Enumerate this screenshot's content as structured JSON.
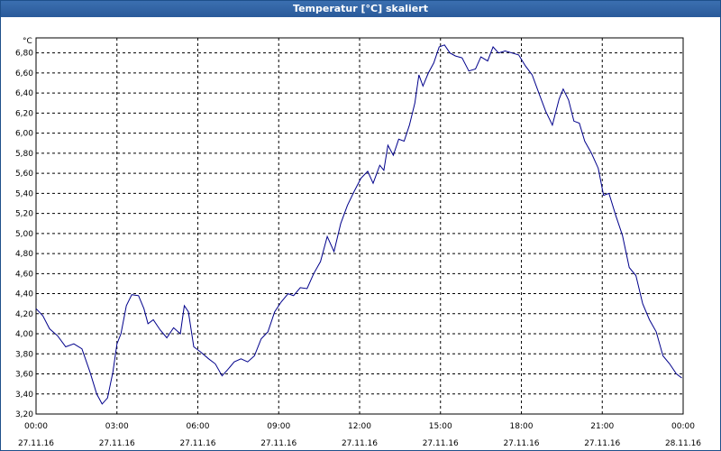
{
  "window": {
    "title": "Temperatur [°C] skaliert"
  },
  "chart_data": {
    "type": "line",
    "title": "Temperatur [°C] skaliert",
    "ylabel": "°C",
    "xlabel": "",
    "grid": true,
    "ylim": [
      3.2,
      6.95
    ],
    "xlim_hours": [
      0,
      24
    ],
    "y_ticks": [
      "3,20",
      "3,40",
      "3,60",
      "3,80",
      "4,00",
      "4,20",
      "4,40",
      "4,60",
      "4,80",
      "5,00",
      "5,20",
      "5,40",
      "5,60",
      "5,80",
      "6,00",
      "6,20",
      "6,40",
      "6,60",
      "6,80"
    ],
    "x_ticks": [
      {
        "time": "00:00",
        "date": "27.11.16"
      },
      {
        "time": "03:00",
        "date": "27.11.16"
      },
      {
        "time": "06:00",
        "date": "27.11.16"
      },
      {
        "time": "09:00",
        "date": "27.11.16"
      },
      {
        "time": "12:00",
        "date": "27.11.16"
      },
      {
        "time": "15:00",
        "date": "27.11.16"
      },
      {
        "time": "18:00",
        "date": "27.11.16"
      },
      {
        "time": "21:00",
        "date": "27.11.16"
      },
      {
        "time": "00:00",
        "date": "28.11.16"
      }
    ],
    "series": [
      {
        "color": "#00008b",
        "points": [
          [
            0.0,
            4.25
          ],
          [
            0.25,
            4.18
          ],
          [
            0.5,
            4.05
          ],
          [
            0.8,
            3.98
          ],
          [
            1.1,
            3.87
          ],
          [
            1.4,
            3.9
          ],
          [
            1.7,
            3.85
          ],
          [
            2.0,
            3.62
          ],
          [
            2.25,
            3.4
          ],
          [
            2.45,
            3.3
          ],
          [
            2.65,
            3.36
          ],
          [
            2.85,
            3.62
          ],
          [
            3.0,
            3.9
          ],
          [
            3.15,
            4.0
          ],
          [
            3.35,
            4.28
          ],
          [
            3.55,
            4.39
          ],
          [
            3.8,
            4.38
          ],
          [
            4.0,
            4.25
          ],
          [
            4.15,
            4.1
          ],
          [
            4.35,
            4.14
          ],
          [
            4.6,
            4.04
          ],
          [
            4.85,
            3.96
          ],
          [
            5.1,
            4.06
          ],
          [
            5.35,
            4.0
          ],
          [
            5.5,
            4.28
          ],
          [
            5.65,
            4.22
          ],
          [
            5.85,
            3.87
          ],
          [
            6.1,
            3.82
          ],
          [
            6.4,
            3.75
          ],
          [
            6.65,
            3.7
          ],
          [
            6.9,
            3.58
          ],
          [
            7.1,
            3.64
          ],
          [
            7.35,
            3.72
          ],
          [
            7.6,
            3.75
          ],
          [
            7.85,
            3.72
          ],
          [
            8.1,
            3.78
          ],
          [
            8.35,
            3.95
          ],
          [
            8.6,
            4.02
          ],
          [
            8.85,
            4.22
          ],
          [
            9.1,
            4.32
          ],
          [
            9.35,
            4.4
          ],
          [
            9.55,
            4.38
          ],
          [
            9.8,
            4.46
          ],
          [
            10.05,
            4.45
          ],
          [
            10.3,
            4.6
          ],
          [
            10.55,
            4.72
          ],
          [
            10.8,
            4.97
          ],
          [
            11.05,
            4.82
          ],
          [
            11.3,
            5.1
          ],
          [
            11.55,
            5.28
          ],
          [
            11.8,
            5.42
          ],
          [
            12.05,
            5.55
          ],
          [
            12.3,
            5.62
          ],
          [
            12.5,
            5.5
          ],
          [
            12.75,
            5.68
          ],
          [
            12.9,
            5.63
          ],
          [
            13.05,
            5.88
          ],
          [
            13.25,
            5.78
          ],
          [
            13.45,
            5.94
          ],
          [
            13.65,
            5.92
          ],
          [
            13.85,
            6.08
          ],
          [
            14.05,
            6.3
          ],
          [
            14.2,
            6.58
          ],
          [
            14.35,
            6.47
          ],
          [
            14.55,
            6.6
          ],
          [
            14.75,
            6.7
          ],
          [
            14.95,
            6.86
          ],
          [
            15.15,
            6.88
          ],
          [
            15.35,
            6.8
          ],
          [
            15.55,
            6.77
          ],
          [
            15.8,
            6.75
          ],
          [
            16.05,
            6.62
          ],
          [
            16.3,
            6.64
          ],
          [
            16.5,
            6.76
          ],
          [
            16.75,
            6.72
          ],
          [
            16.95,
            6.86
          ],
          [
            17.15,
            6.8
          ],
          [
            17.4,
            6.82
          ],
          [
            17.65,
            6.8
          ],
          [
            17.9,
            6.78
          ],
          [
            18.15,
            6.67
          ],
          [
            18.4,
            6.58
          ],
          [
            18.65,
            6.4
          ],
          [
            18.9,
            6.22
          ],
          [
            19.15,
            6.08
          ],
          [
            19.4,
            6.34
          ],
          [
            19.55,
            6.44
          ],
          [
            19.75,
            6.33
          ],
          [
            19.95,
            6.12
          ],
          [
            20.15,
            6.1
          ],
          [
            20.35,
            5.92
          ],
          [
            20.6,
            5.8
          ],
          [
            20.85,
            5.65
          ],
          [
            21.05,
            5.38
          ],
          [
            21.25,
            5.4
          ],
          [
            21.5,
            5.18
          ],
          [
            21.75,
            4.98
          ],
          [
            22.0,
            4.66
          ],
          [
            22.25,
            4.58
          ],
          [
            22.5,
            4.3
          ],
          [
            22.75,
            4.14
          ],
          [
            23.0,
            4.02
          ],
          [
            23.25,
            3.78
          ],
          [
            23.5,
            3.7
          ],
          [
            23.75,
            3.6
          ],
          [
            23.95,
            3.56
          ]
        ]
      }
    ]
  }
}
